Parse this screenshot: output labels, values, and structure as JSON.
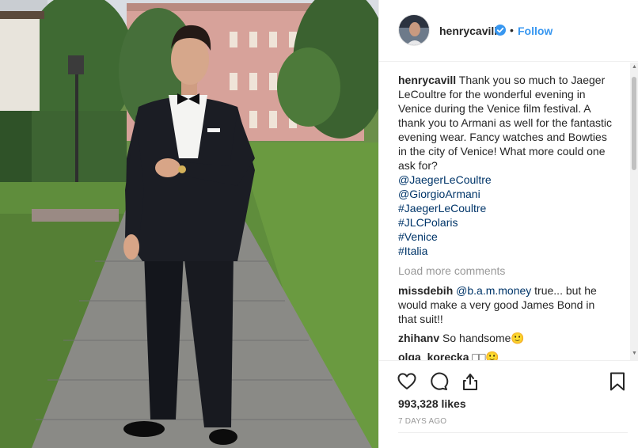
{
  "post": {
    "photo_alt": "Man in black tuxedo standing on a stone path in a garden with a pink building behind",
    "author": {
      "username": "henrycavill",
      "verified": true,
      "follow_label": "Follow",
      "separator": "•"
    },
    "caption": {
      "username": "henrycavill",
      "text": "Thank you so much to Jaeger LeCoultre for the wonderful evening in Venice during the Venice film festival. A thank you to Armani as well for the fantastic evening wear. Fancy watches and Bowties in the city of Venice! What more could one ask for?",
      "tags": [
        "@JaegerLeCoultre",
        "@GiorgioArmani",
        "#JaegerLeCoultre",
        "#JLCPolaris",
        "#Venice",
        "#Italia"
      ]
    },
    "load_more_label": "Load more comments",
    "comments": [
      {
        "username": "missdebih",
        "mention": "@b.a.m.money",
        "text": "true... but he would make a very good James Bond in that suit!!"
      },
      {
        "username": "zhihanv",
        "mention": "",
        "text": "So handsome🙂"
      },
      {
        "username": "olga_korecka",
        "mention": "",
        "text": "□□🙂"
      }
    ],
    "likes_label": "993,328 likes",
    "time_ago": "7 DAYS AGO"
  },
  "icons": {
    "like": "heart-icon",
    "comment": "comment-bubble-icon",
    "share": "share-icon",
    "save": "bookmark-icon",
    "verified": "verified-badge-icon"
  },
  "colors": {
    "link_blue": "#3897f0",
    "tag_blue": "#003569",
    "muted_gray": "#999999",
    "border": "#efefef"
  }
}
